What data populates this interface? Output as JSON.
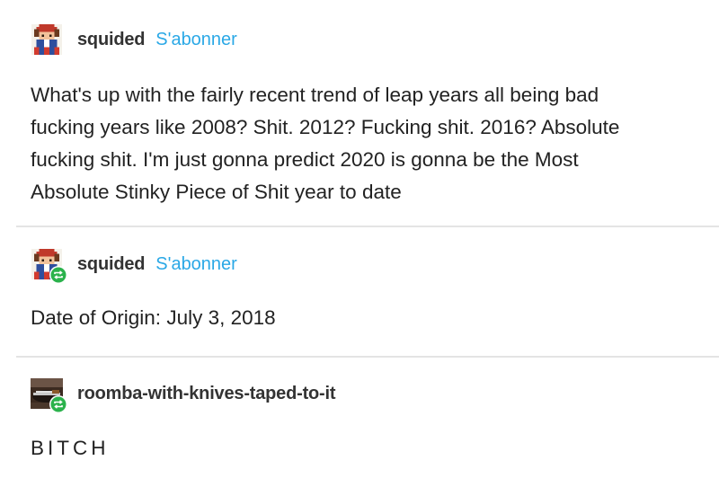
{
  "posts": [
    {
      "username": "squided",
      "follow_label": "S'abonner",
      "avatar_icon": "pixel-character-avatar-icon",
      "body_lines": [
        "What's up with the fairly recent trend of leap years all being bad",
        "fucking years like 2008? Shit. 2012? Fucking shit. 2016? Absolute",
        "fucking shit. I'm just gonna predict 2020 is gonna be the Most",
        "Absolute Stinky Piece of Shit year to date"
      ]
    },
    {
      "username": "squided",
      "follow_label": "S'abonner",
      "avatar_icon": "pixel-character-avatar-icon",
      "reblog_icon": "reblog-icon",
      "body": "Date of Origin: July 3, 2018"
    },
    {
      "username": "roomba-with-knives-taped-to-it",
      "avatar_icon": "knife-avatar-icon",
      "reblog_icon": "reblog-icon",
      "body": "BITCH"
    }
  ],
  "colors": {
    "follow": "#2aa8e6",
    "reblog_badge": "#2bb24c",
    "divider": "#e4e4e4"
  }
}
